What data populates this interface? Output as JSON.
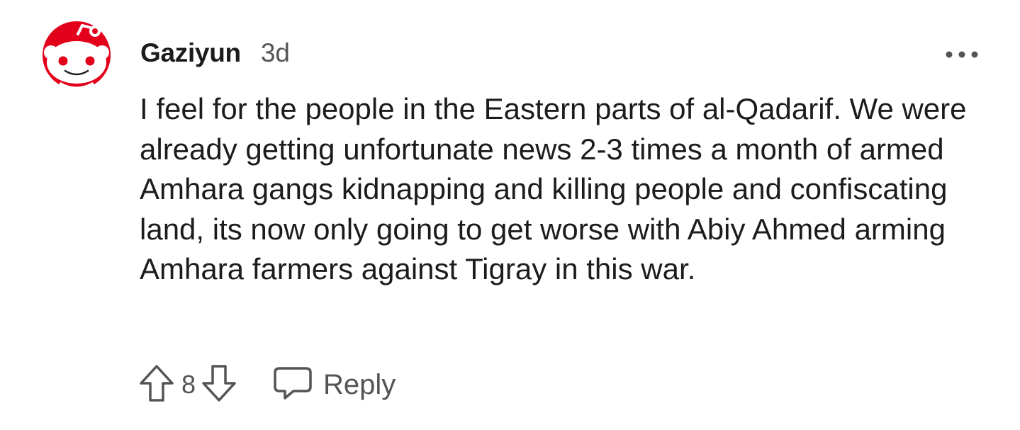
{
  "comment": {
    "author": "Gaziyun",
    "age": "3d",
    "body": "I feel for the people in the Eastern parts of al-Qadarif. We were already getting unfortunate news 2-3 times a month of armed Amhara gangs kidnapping and killing people and confiscating land, its now only going to get worse with Abiy Ahmed arming Amhara farmers against Tigray in this war.",
    "score": "8",
    "reply_label": "Reply"
  },
  "icons": {
    "avatar": "snoo-avatar-icon",
    "more": "more-options-icon",
    "upvote": "upvote-arrow-icon",
    "downvote": "downvote-arrow-icon",
    "reply": "speech-bubble-icon"
  },
  "colors": {
    "avatar_red": "#e3001b",
    "text": "#1c1c1c",
    "secondary": "#545454"
  }
}
